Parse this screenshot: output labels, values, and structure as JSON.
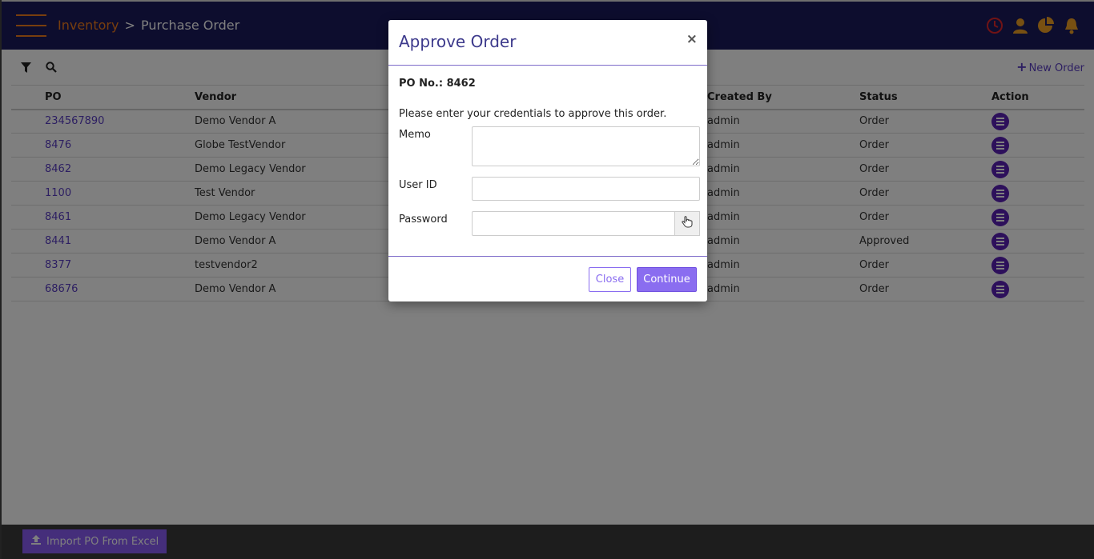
{
  "header": {
    "breadcrumb_root": "Inventory",
    "breadcrumb_sep": ">",
    "breadcrumb_current": "Purchase Order",
    "icons": [
      "clock-icon",
      "user-icon",
      "pie-chart-icon",
      "bell-icon"
    ],
    "colors": {
      "bg": "#1b1a5c",
      "accent": "#f07c1c",
      "clock": "#e0262b"
    }
  },
  "toolbar": {
    "filter_icon": "filter-icon",
    "search_icon": "search-icon",
    "new_order_label": "New Order",
    "new_order_plus": "+"
  },
  "table": {
    "columns": [
      "PO",
      "Vendor",
      "Created By",
      "Status",
      "Action"
    ],
    "rows": [
      {
        "po": "234567890",
        "vendor": "Demo Vendor A",
        "created_by": "admin",
        "status": "Order"
      },
      {
        "po": "8476",
        "vendor": "Globe TestVendor",
        "created_by": "admin",
        "status": "Order"
      },
      {
        "po": "8462",
        "vendor": "Demo Legacy Vendor",
        "created_by": "admin",
        "status": "Order"
      },
      {
        "po": "1100",
        "vendor": "Test Vendor",
        "created_by": "admin",
        "status": "Order"
      },
      {
        "po": "8461",
        "vendor": "Demo Legacy Vendor",
        "created_by": "admin",
        "status": "Order"
      },
      {
        "po": "8441",
        "vendor": "Demo Vendor A",
        "created_by": "admin",
        "status": "Approved"
      },
      {
        "po": "8377",
        "vendor": "testvendor2",
        "created_by": "admin",
        "status": "Order"
      },
      {
        "po": "68676",
        "vendor": "Demo Vendor A",
        "created_by": "admin",
        "status": "Order"
      }
    ]
  },
  "footer": {
    "import_label": "Import PO From Excel",
    "import_icon": "upload-icon"
  },
  "modal": {
    "title": "Approve Order",
    "close_symbol": "×",
    "po_number_text": "PO No.: 8462",
    "instruction": "Please enter your credentials to approve this order.",
    "memo_label": "Memo",
    "memo_value": "",
    "user_id_label": "User ID",
    "user_id_value": "",
    "password_label": "Password",
    "password_value": "",
    "password_button_icon": "pointer-hand-icon",
    "close_button": "Close",
    "continue_button": "Continue",
    "colors": {
      "title": "#3d3a8c",
      "button": "#8a6df0"
    }
  }
}
